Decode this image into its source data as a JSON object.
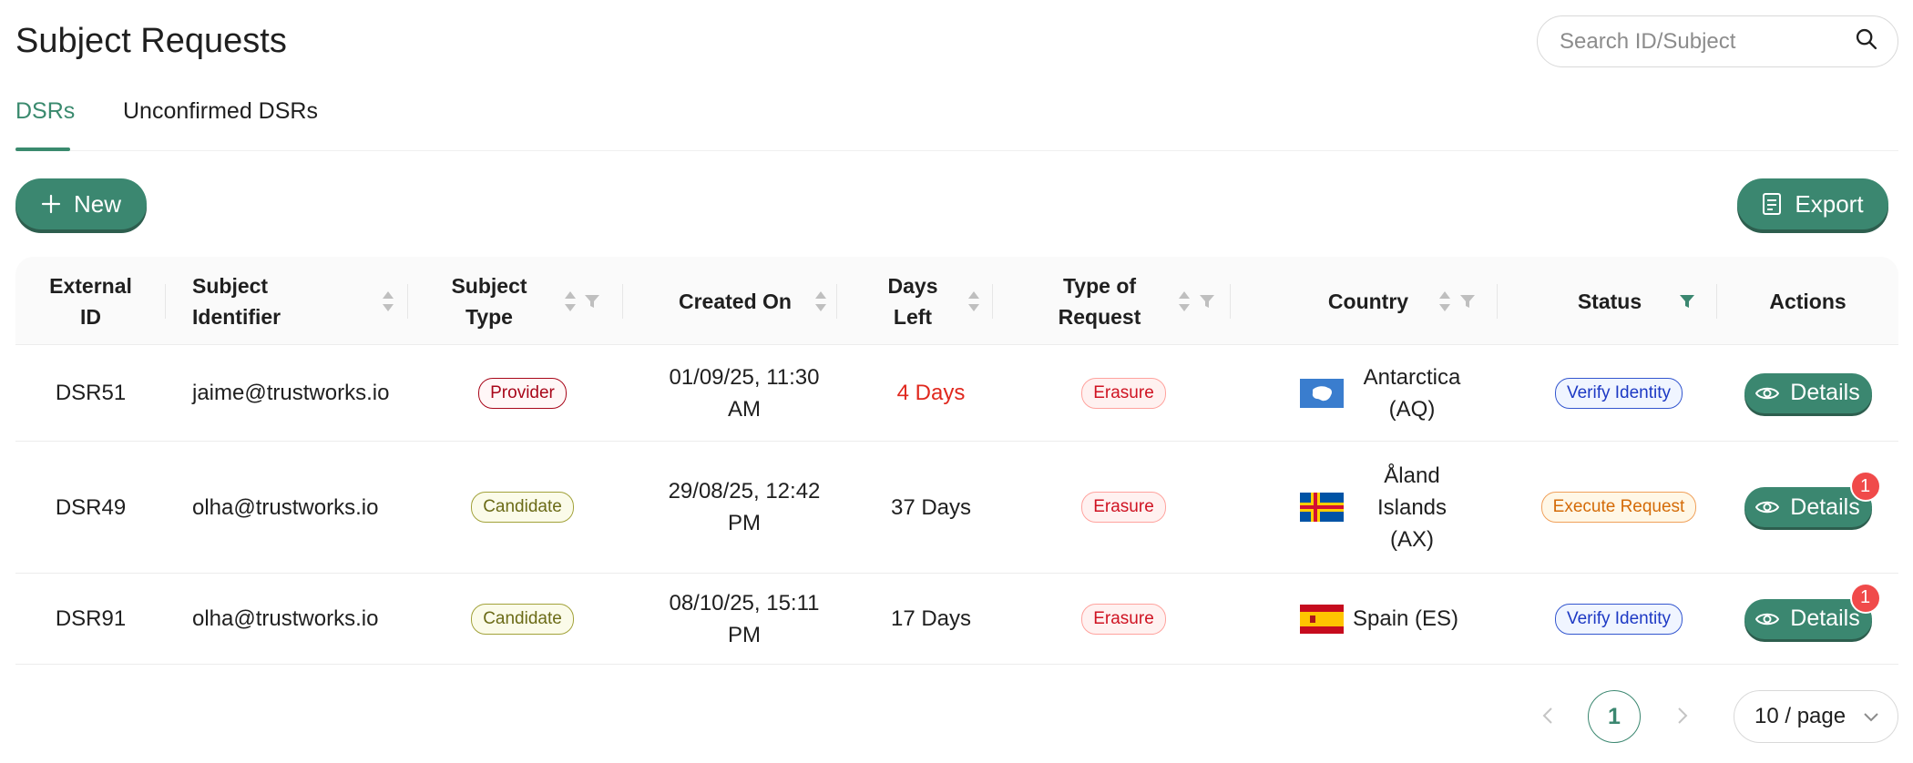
{
  "page": {
    "title": "Subject Requests"
  },
  "search": {
    "placeholder": "Search ID/Subject"
  },
  "tabs": [
    {
      "label": "DSRs",
      "active": true
    },
    {
      "label": "Unconfirmed DSRs",
      "active": false
    }
  ],
  "toolbar": {
    "new_label": "New",
    "export_label": "Export"
  },
  "table": {
    "headers": {
      "external_id": "External ID",
      "subject_identifier": "Subject Identifier",
      "subject_type": "Subject Type",
      "created_on": "Created On",
      "days_left": "Days Left",
      "type_of_request": "Type of Request",
      "country": "Country",
      "status": "Status",
      "actions": "Actions"
    },
    "rows": [
      {
        "external_id": "DSR51",
        "subject_identifier": "jaime@trustworks.io",
        "subject_type": "Provider",
        "created_on": "01/09/25, 11:30 AM",
        "days_left": "4 Days",
        "type_of_request": "Erasure",
        "country": "Antarctica (AQ)",
        "status": "Verify Identity",
        "action_label": "Details",
        "badge": ""
      },
      {
        "external_id": "DSR49",
        "subject_identifier": "olha@trustworks.io",
        "subject_type": "Candidate",
        "created_on": "29/08/25, 12:42 PM",
        "days_left": "37 Days",
        "type_of_request": "Erasure",
        "country": "Åland Islands (AX)",
        "status": "Execute Request",
        "action_label": "Details",
        "badge": "1"
      },
      {
        "external_id": "DSR91",
        "subject_identifier": "olha@trustworks.io",
        "subject_type": "Candidate",
        "created_on": "08/10/25, 15:11 PM",
        "days_left": "17 Days",
        "type_of_request": "Erasure",
        "country": "Spain (ES)",
        "status": "Verify Identity",
        "action_label": "Details",
        "badge": "1"
      }
    ]
  },
  "pagination": {
    "current_page": "1",
    "page_size": "10 / page"
  },
  "colors": {
    "accent": "#3b8770",
    "danger": "#e0281e",
    "badge": "#f04a4a"
  },
  "icons": [
    "search-icon",
    "plus-icon",
    "export-icon",
    "sort-icon",
    "filter-icon",
    "eye-icon",
    "chevron-left-icon",
    "chevron-right-icon",
    "chevron-down-icon"
  ]
}
